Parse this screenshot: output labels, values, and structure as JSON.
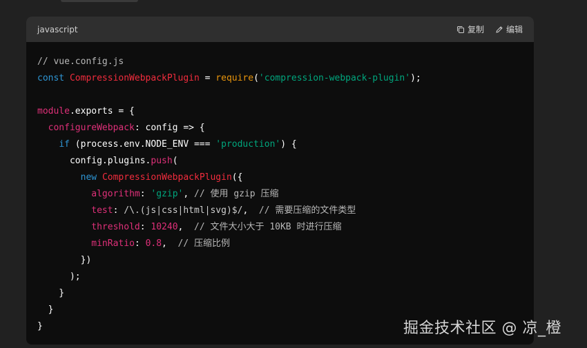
{
  "code_block": {
    "language": "javascript",
    "actions": {
      "copy_label": "复制",
      "edit_label": "编辑"
    },
    "lines": [
      [
        {
          "t": "comment",
          "v": "// vue.config.js"
        }
      ],
      [
        {
          "t": "keyword",
          "v": "const"
        },
        {
          "t": "plain",
          "v": " "
        },
        {
          "t": "class",
          "v": "CompressionWebpackPlugin"
        },
        {
          "t": "plain",
          "v": " = "
        },
        {
          "t": "func",
          "v": "require"
        },
        {
          "t": "plain",
          "v": "("
        },
        {
          "t": "string",
          "v": "'compression-webpack-plugin'"
        },
        {
          "t": "plain",
          "v": ");"
        }
      ],
      [],
      [
        {
          "t": "attr",
          "v": "module"
        },
        {
          "t": "plain",
          "v": ".exports = {"
        }
      ],
      [
        {
          "t": "plain",
          "v": "  "
        },
        {
          "t": "attr",
          "v": "configureWebpack"
        },
        {
          "t": "plain",
          "v": ": config => {"
        }
      ],
      [
        {
          "t": "plain",
          "v": "    "
        },
        {
          "t": "keyword",
          "v": "if"
        },
        {
          "t": "plain",
          "v": " (process.env.NODE_ENV === "
        },
        {
          "t": "string",
          "v": "'production'"
        },
        {
          "t": "plain",
          "v": ") {"
        }
      ],
      [
        {
          "t": "plain",
          "v": "      config.plugins."
        },
        {
          "t": "attr",
          "v": "push"
        },
        {
          "t": "plain",
          "v": "("
        }
      ],
      [
        {
          "t": "plain",
          "v": "        "
        },
        {
          "t": "keyword",
          "v": "new"
        },
        {
          "t": "plain",
          "v": " "
        },
        {
          "t": "class",
          "v": "CompressionWebpackPlugin"
        },
        {
          "t": "plain",
          "v": "({"
        }
      ],
      [
        {
          "t": "plain",
          "v": "          "
        },
        {
          "t": "attr",
          "v": "algorithm"
        },
        {
          "t": "plain",
          "v": ": "
        },
        {
          "t": "string",
          "v": "'gzip'"
        },
        {
          "t": "plain",
          "v": ", "
        },
        {
          "t": "comment",
          "v": "// 使用 gzip 压缩"
        }
      ],
      [
        {
          "t": "plain",
          "v": "          "
        },
        {
          "t": "attr",
          "v": "test"
        },
        {
          "t": "plain",
          "v": ": "
        },
        {
          "t": "regex",
          "v": "/\\.(js|css|html|svg)$/"
        },
        {
          "t": "plain",
          "v": ",  "
        },
        {
          "t": "comment",
          "v": "// 需要压缩的文件类型"
        }
      ],
      [
        {
          "t": "plain",
          "v": "          "
        },
        {
          "t": "attr",
          "v": "threshold"
        },
        {
          "t": "plain",
          "v": ": "
        },
        {
          "t": "number",
          "v": "10240"
        },
        {
          "t": "plain",
          "v": ",  "
        },
        {
          "t": "comment",
          "v": "// 文件大小大于 10KB 时进行压缩"
        }
      ],
      [
        {
          "t": "plain",
          "v": "          "
        },
        {
          "t": "attr",
          "v": "minRatio"
        },
        {
          "t": "plain",
          "v": ": "
        },
        {
          "t": "number",
          "v": "0.8"
        },
        {
          "t": "plain",
          "v": ",  "
        },
        {
          "t": "comment",
          "v": "// 压缩比例"
        }
      ],
      [
        {
          "t": "plain",
          "v": "        })"
        }
      ],
      [
        {
          "t": "plain",
          "v": "      );"
        }
      ],
      [
        {
          "t": "plain",
          "v": "    }"
        }
      ],
      [
        {
          "t": "plain",
          "v": "  }"
        }
      ],
      [
        {
          "t": "plain",
          "v": "}"
        }
      ]
    ]
  },
  "watermark": "掘金技术社区 @ 凉_橙"
}
